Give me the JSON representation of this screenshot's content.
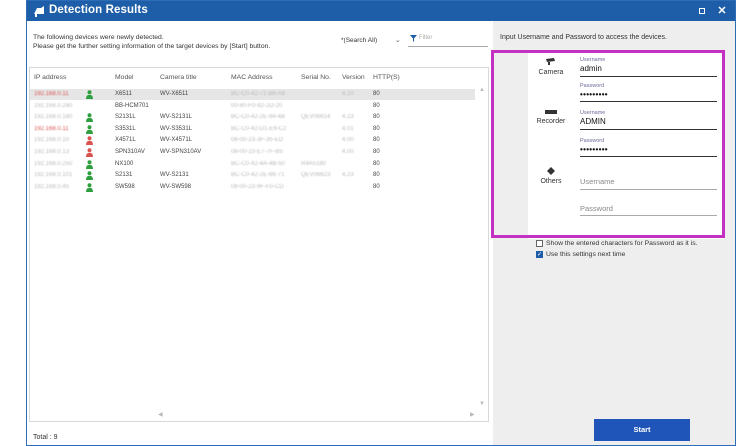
{
  "window": {
    "title": "Detection Results",
    "title_color": "#1e5ea8"
  },
  "left": {
    "info_line1": "The following devices were newly detected.",
    "info_line2": "Please get the further setting information of the target devices by [Start] button.",
    "search_scope": "*(Search All)",
    "filter_placeholder": "Filter",
    "columns": [
      "IP address",
      "Model",
      "Camera title",
      "MAC Address",
      "Serial No.",
      "Version",
      "HTTP(S)"
    ],
    "rows": [
      {
        "ip": "192.168.0.11",
        "ip_red": true,
        "status": "green",
        "model": "X6511",
        "title": "WV-X6511",
        "mac": "BC-C0-42-71-B6-A8",
        "serial": "",
        "version": "4.10",
        "http": "80",
        "selected": true
      },
      {
        "ip": "192.168.0.240",
        "ip_red": false,
        "status": "",
        "model": "BB-HCM701",
        "title": "",
        "mac": "00-80-F0-82-2D-20",
        "serial": "",
        "version": "",
        "http": "80",
        "selected": false
      },
      {
        "ip": "192.168.0.180",
        "ip_red": false,
        "status": "green",
        "model": "S2131L",
        "title": "WV-S2131L",
        "mac": "BC-C0-42-2E-94-4B",
        "serial": "QEV06614",
        "version": "4.23",
        "http": "80",
        "selected": false
      },
      {
        "ip": "192.168.0.11",
        "ip_red": true,
        "status": "green",
        "model": "S3531L",
        "title": "WV-S3531L",
        "mac": "BC-C0-42-D1-E9-C2",
        "serial": "",
        "version": "4.01",
        "http": "80",
        "selected": false
      },
      {
        "ip": "192.168.0.10",
        "ip_red": false,
        "status": "red",
        "model": "X4571L",
        "title": "WV-X4571L",
        "mac": "08-00-23-3F-35-ED",
        "serial": "",
        "version": "4.00",
        "http": "80",
        "selected": false
      },
      {
        "ip": "192.168.0.13",
        "ip_red": false,
        "status": "red",
        "model": "SPN310AV",
        "title": "WV-SPN310AV",
        "mac": "08-00-23-E7-7F-B5",
        "serial": "",
        "version": "4.00",
        "http": "80",
        "selected": false
      },
      {
        "ip": "192.168.0.250",
        "ip_red": false,
        "status": "green",
        "model": "NX100",
        "title": "",
        "mac": "BC-C0-42-4A-4B-50",
        "serial": "R4A5180",
        "version": "",
        "http": "80",
        "selected": false
      },
      {
        "ip": "192.168.0.101",
        "ip_red": false,
        "status": "green",
        "model": "S2131",
        "title": "WV-S2131",
        "mac": "BC-C0-42-2E-66-71",
        "serial": "QEV06623",
        "version": "4.23",
        "http": "80",
        "selected": false
      },
      {
        "ip": "192.168.0.45",
        "ip_red": false,
        "status": "green",
        "model": "SW598",
        "title": "WV-SW598",
        "mac": "08-00-23-9F-F0-CD",
        "serial": "",
        "version": "",
        "http": "80",
        "selected": false
      }
    ],
    "total": "Total : 9"
  },
  "right": {
    "header": "Input Username and Password to access the devices.",
    "categories": [
      {
        "name": "Camera",
        "icon": "camera-icon",
        "username_label": "Username",
        "username": "admin",
        "password_label": "Password",
        "password_mask": "•••••••••"
      },
      {
        "name": "Recorder",
        "icon": "recorder-icon",
        "username_label": "Username",
        "username": "ADMIN",
        "password_label": "Password",
        "password_mask": "•••••••••"
      },
      {
        "name": "Others",
        "icon": "diamond-icon",
        "username_placeholder": "Username",
        "password_placeholder": "Password"
      }
    ],
    "show_chars_label": "Show the entered characters for Password as it is.",
    "show_chars_checked": false,
    "use_settings_label": "Use this settings next time",
    "use_settings_checked": true,
    "start_label": "Start",
    "highlight_color": "#c430c4"
  }
}
